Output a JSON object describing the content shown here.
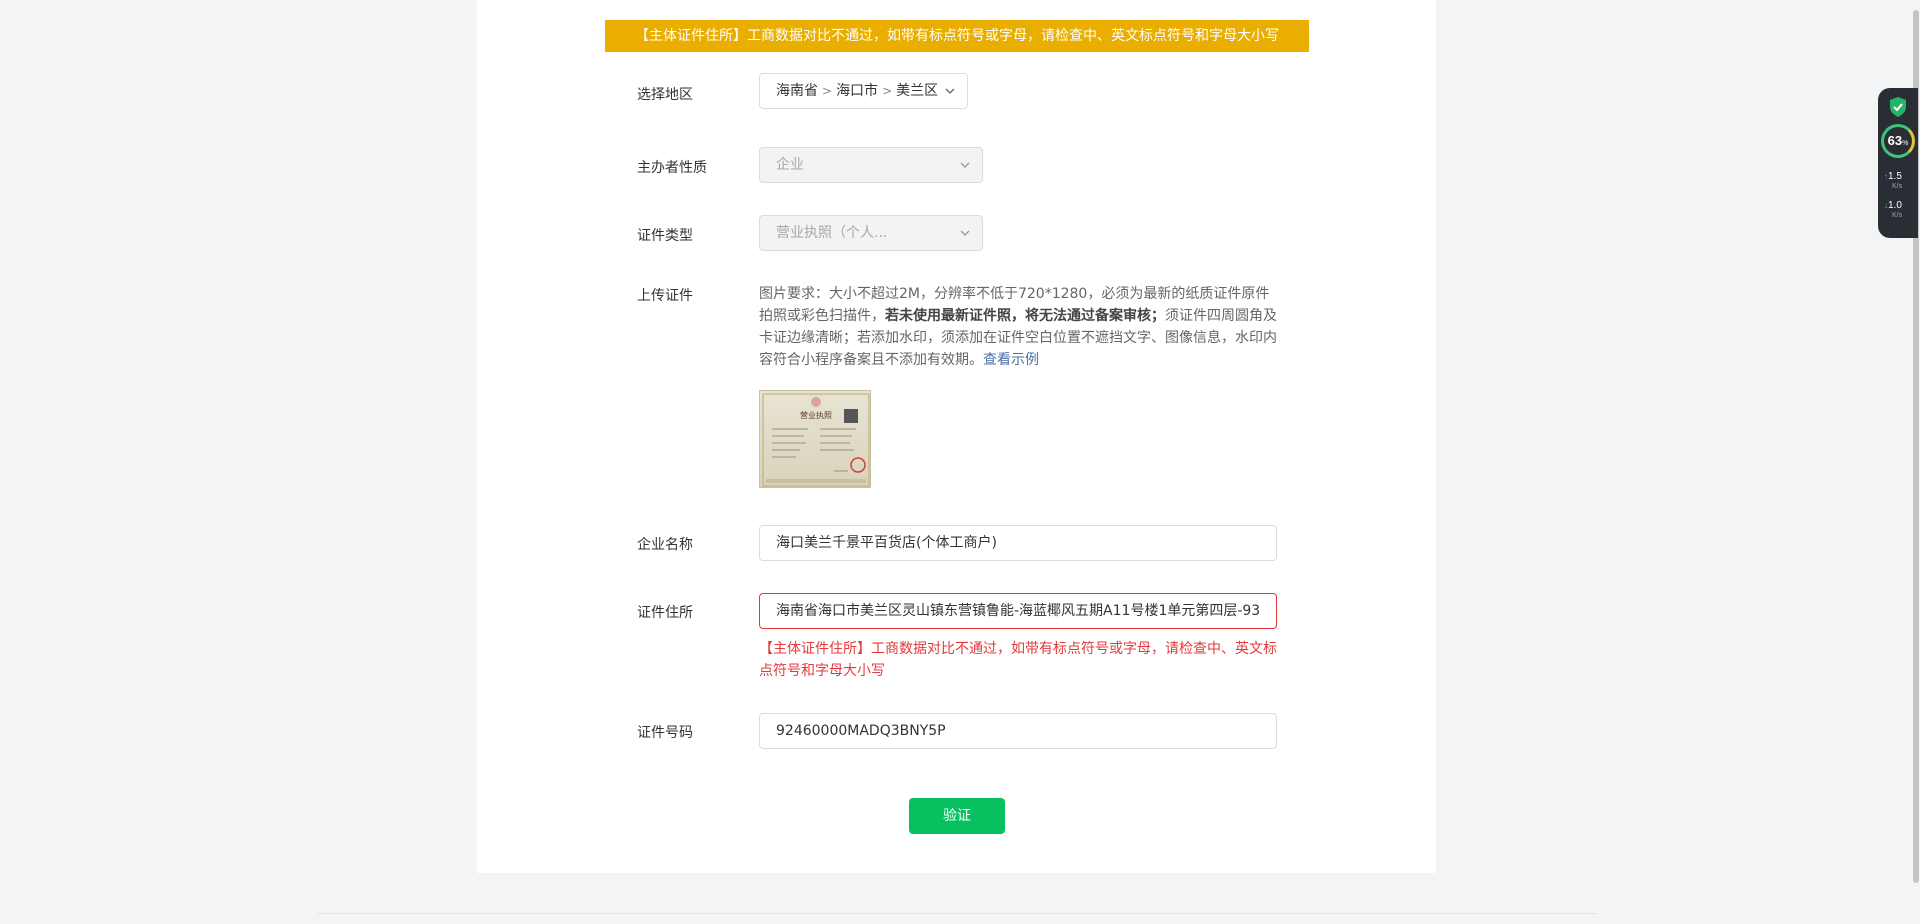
{
  "banner": "【主体证件住所】工商数据对比不通过，如带有标点符号或字母，请检查中、英文标点符号和字母大小写",
  "form": {
    "region": {
      "label": "选择地区",
      "province": "海南省",
      "city": "海口市",
      "district": "美兰区"
    },
    "organizer_nature": {
      "label": "主办者性质",
      "value": "企业"
    },
    "cert_type": {
      "label": "证件类型",
      "value": "营业执照（个人..."
    },
    "upload": {
      "label": "上传证件",
      "desc_part1": "图片要求：大小不超过2M，分辨率不低于720*1280，必须为最新的纸质证件原件拍照或彩色扫描件，",
      "desc_bold": "若未使用最新证件照，将无法通过备案审核；",
      "desc_part2": "须证件四周圆角及卡证边缘清晰；若添加水印，须添加在证件空白位置不遮挡文字、图像信息，水印内容符合小程序备案且不添加有效期。",
      "example_link": "查看示例",
      "license_title": "营业执照"
    },
    "company_name": {
      "label": "企业名称",
      "value": "海口美兰千景平百货店(个体工商户)"
    },
    "address": {
      "label": "证件住所",
      "value": "海南省海口市美兰区灵山镇东营镇鲁能-海蓝椰风五期A11号楼1单元第四层-93",
      "error": "【主体证件住所】工商数据对比不通过，如带有标点符号或字母，请检查中、英文标点符号和字母大小写"
    },
    "cert_number": {
      "label": "证件号码",
      "value": "92460000MADQ3BNY5P"
    },
    "verify_button": "验证"
  },
  "monitor": {
    "percent": "63",
    "percent_unit": "%",
    "upload_speed": "1.5",
    "download_speed": "1.0",
    "speed_unit": "K/s"
  },
  "colors": {
    "banner_bg": "#eaae00",
    "error": "#e4393c",
    "primary": "#07c160",
    "link": "#4a6fa5"
  }
}
